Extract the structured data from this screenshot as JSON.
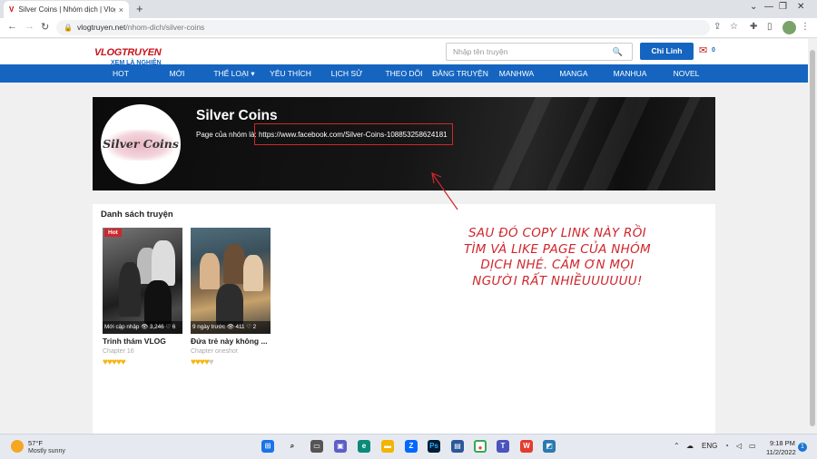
{
  "browser": {
    "tab_title": "Silver Coins | Nhóm dịch | Vlogtr",
    "tab_close": "×",
    "new_tab": "+",
    "url_host": "vlogtruyen.net",
    "url_path": "/nhom-dich/silver-coins"
  },
  "site": {
    "logo_main": "VLOGTRUYEN",
    "logo_sub": "XEM LÀ NGHIỆN",
    "search_placeholder": "Nhập tên truyện",
    "login_label": "Chi Linh",
    "notif_count": "0",
    "nav": [
      "HOT",
      "MỚI",
      "THỂ LOẠI ▾",
      "YÊU THÍCH",
      "LỊCH SỬ",
      "THEO DÕI",
      "ĐĂNG TRUYỆN",
      "MANHWA",
      "MANGA",
      "MANHUA",
      "NOVEL"
    ]
  },
  "group": {
    "avatar_text": "Silver Coins",
    "name": "Silver Coins",
    "desc_prefix": "Page của nhóm là: ",
    "desc_link": "https://www.facebook.com/Silver-Coins-108853258624181"
  },
  "list": {
    "title": "Danh sách truyện",
    "cards": [
      {
        "badge": "Hot",
        "meta": "Mới cập nhập 👁 3,246 ♡ 6",
        "title": "Trinh thám VLOG",
        "chapter": "Chapter 16",
        "rating": 5
      },
      {
        "badge": "",
        "meta": "9 ngày trước 👁 411 ♡ 2",
        "title": "Đứa trẻ này không ...",
        "chapter": "Chapter oneshot",
        "rating": 4
      }
    ]
  },
  "annotation": "Sau đó copy link này rồi tìm và like page của nhóm dịch nhé. Cảm ơn mọi người rất nhiềuuuuuu!",
  "taskbar": {
    "temp": "57°F",
    "weather": "Mostly sunny",
    "lang": "ENG",
    "time": "9:18 PM",
    "date": "11/2/2022",
    "notif_count": "1"
  },
  "colors": {
    "brand_blue": "#1565c0",
    "brand_red": "#c9141b",
    "annotation_red": "#d0262d",
    "heart_gold": "#f5b50a"
  }
}
